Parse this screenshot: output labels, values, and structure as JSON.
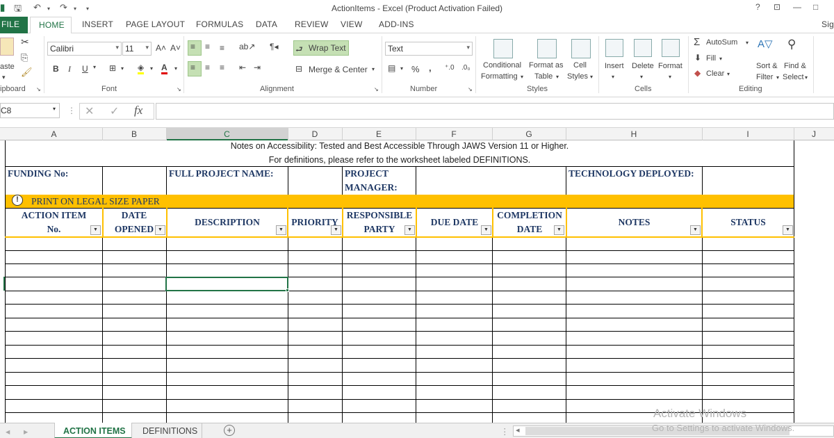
{
  "window": {
    "title": "ActionItems - Excel (Product Activation Failed)",
    "help": "?",
    "minimize": "—",
    "restore": "□"
  },
  "tabs": [
    "FILE",
    "HOME",
    "INSERT",
    "PAGE LAYOUT",
    "FORMULAS",
    "DATA",
    "REVIEW",
    "VIEW",
    "ADD-INS"
  ],
  "account": "Sig",
  "ribbon": {
    "clipboard": {
      "paste": "aste",
      "label": "ipboard"
    },
    "font": {
      "name": "Calibri",
      "size": "11",
      "grow": "A˄",
      "shrink": "A˅",
      "bold": "B",
      "italic": "I",
      "underline": "U",
      "label": "Font"
    },
    "alignment": {
      "wrap": "Wrap Text",
      "merge": "Merge & Center",
      "label": "Alignment"
    },
    "number": {
      "format": "Text",
      "percent": "%",
      "comma": ",",
      "label": "Number"
    },
    "styles": {
      "conditional": [
        "Conditional",
        "Formatting"
      ],
      "format_table": [
        "Format as",
        "Table"
      ],
      "cell_styles": [
        "Cell",
        "Styles"
      ],
      "label": "Styles"
    },
    "cells": {
      "insert": "Insert",
      "delete": "Delete",
      "format": "Format",
      "label": "Cells"
    },
    "editing": {
      "autosum": "AutoSum",
      "fill": "Fill",
      "clear": "Clear",
      "sort": [
        "Sort &",
        "Filter"
      ],
      "find": [
        "Find &",
        "Select"
      ],
      "label": "Editing"
    }
  },
  "formula_bar": {
    "name_box": "C8",
    "fx": "fx",
    "value": ""
  },
  "columns": [
    "A",
    "B",
    "C",
    "D",
    "E",
    "F",
    "G",
    "H",
    "I",
    "J"
  ],
  "sheet": {
    "note1": "Notes on Accessibility:  Tested and Best Accessible Through JAWS Version 11 or Higher.",
    "note2": "For definitions, please refer to the worksheet labeled DEFINITIONS.",
    "funding": "FUNDING No:",
    "project_name": "FULL PROJECT NAME:",
    "manager": [
      "PROJECT",
      "MANAGER:"
    ],
    "technology": "TECHNOLOGY DEPLOYED:",
    "banner": "PRINT ON LEGAL SIZE PAPER",
    "banner_color": "#ffc000",
    "headers": [
      [
        "ACTION ITEM",
        "No."
      ],
      [
        "DATE",
        "OPENED"
      ],
      [
        "DESCRIPTION"
      ],
      [
        "PRIORITY"
      ],
      [
        "RESPONSIBLE",
        "PARTY"
      ],
      [
        "DUE DATE"
      ],
      [
        "COMPLETION",
        "DATE"
      ],
      [
        "NOTES"
      ],
      [
        "STATUS"
      ]
    ]
  },
  "sheet_tabs": {
    "active": "ACTION ITEMS",
    "other": "DEFINITIONS",
    "add": "+"
  },
  "watermark": {
    "line1": "Activate Windows",
    "line2": "Go to Settings to activate Windows."
  },
  "colors": {
    "excel_green": "#217346",
    "header_text": "#1f3864",
    "selection": "#217346"
  }
}
